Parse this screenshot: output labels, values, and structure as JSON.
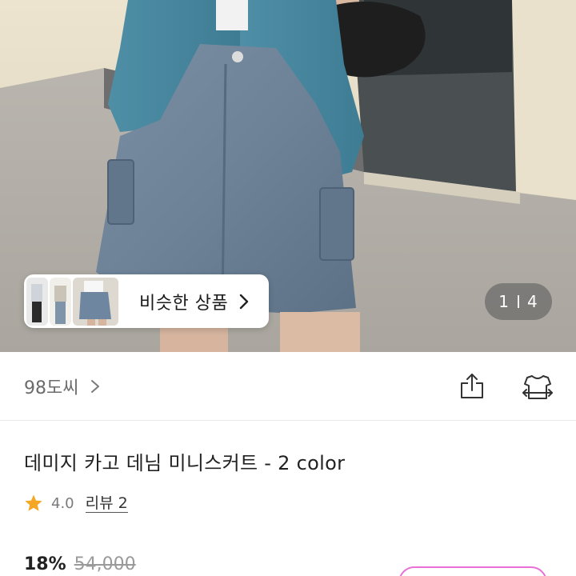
{
  "hero": {
    "photo_icon": "product-photo",
    "similar_products": {
      "label": "비슷한 상품",
      "icon": "chevron-right-icon"
    },
    "counter": {
      "current": "1",
      "total": "4"
    }
  },
  "seller": {
    "name": "98도씨",
    "icons": [
      "share-icon",
      "wardrobe-icon"
    ]
  },
  "product": {
    "title": "데미지 카고 데님 미니스커트 - 2 color",
    "rating": "4.0",
    "review_link": "리뷰 2",
    "discount": "18%",
    "original_price": "54,000"
  },
  "colors": {
    "star": "#F5A623",
    "accent_pink": "#EA6FD6"
  }
}
